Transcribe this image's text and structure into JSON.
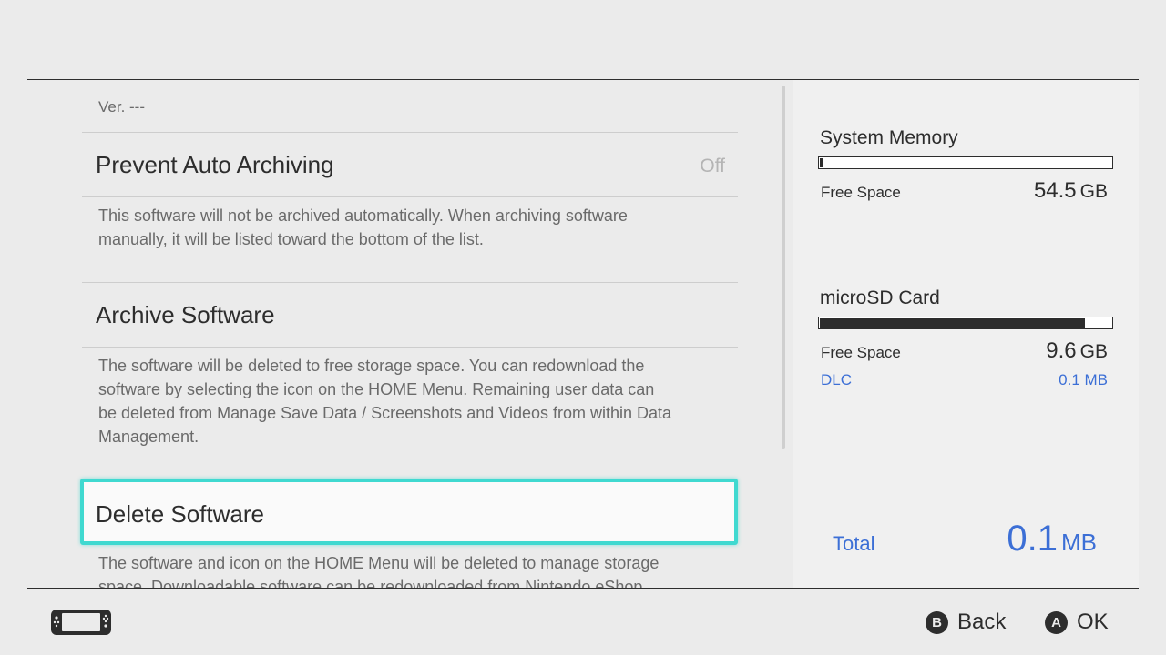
{
  "list": {
    "version": "Ver. ---",
    "rows": [
      {
        "title": "Prevent Auto Archiving",
        "value": "Off",
        "description_lines": [
          "This software will not be archived automatically. When archiving software",
          "manually, it will be listed toward the bottom of the list."
        ]
      },
      {
        "title": "Archive Software",
        "description_lines": [
          "The software will be deleted to free storage space. You can redownload the",
          "software by selecting the icon on the HOME Menu. Remaining user data can",
          "be deleted from Manage Save Data / Screenshots and Videos from within Data",
          "Management."
        ]
      },
      {
        "title": "Delete Software",
        "selected": true,
        "description_lines": [
          "The software and icon on the HOME Menu will be deleted to manage storage",
          "space. Downloadable software can be redownloaded from Nintendo eShop."
        ]
      }
    ]
  },
  "storage": {
    "system_memory": {
      "title": "System Memory",
      "used_fraction": 0.01,
      "free_label": "Free Space",
      "free_value": "54.5",
      "free_unit": "GB"
    },
    "microsd": {
      "title": "microSD Card",
      "used_fraction": 0.91,
      "free_label": "Free Space",
      "free_value": "9.6",
      "free_unit": "GB",
      "dlc_label": "DLC",
      "dlc_value": "0.1 MB"
    },
    "total": {
      "label": "Total",
      "value": "0.1",
      "unit": "MB"
    }
  },
  "footer": {
    "back_key": "B",
    "back_label": "Back",
    "ok_key": "A",
    "ok_label": "OK"
  },
  "colors": {
    "accent": "#40d9d0",
    "link_blue": "#3c6fd6",
    "text": "#2d2d2d",
    "background": "#ebebeb"
  },
  "icons": {
    "console": "switch-console-icon"
  }
}
